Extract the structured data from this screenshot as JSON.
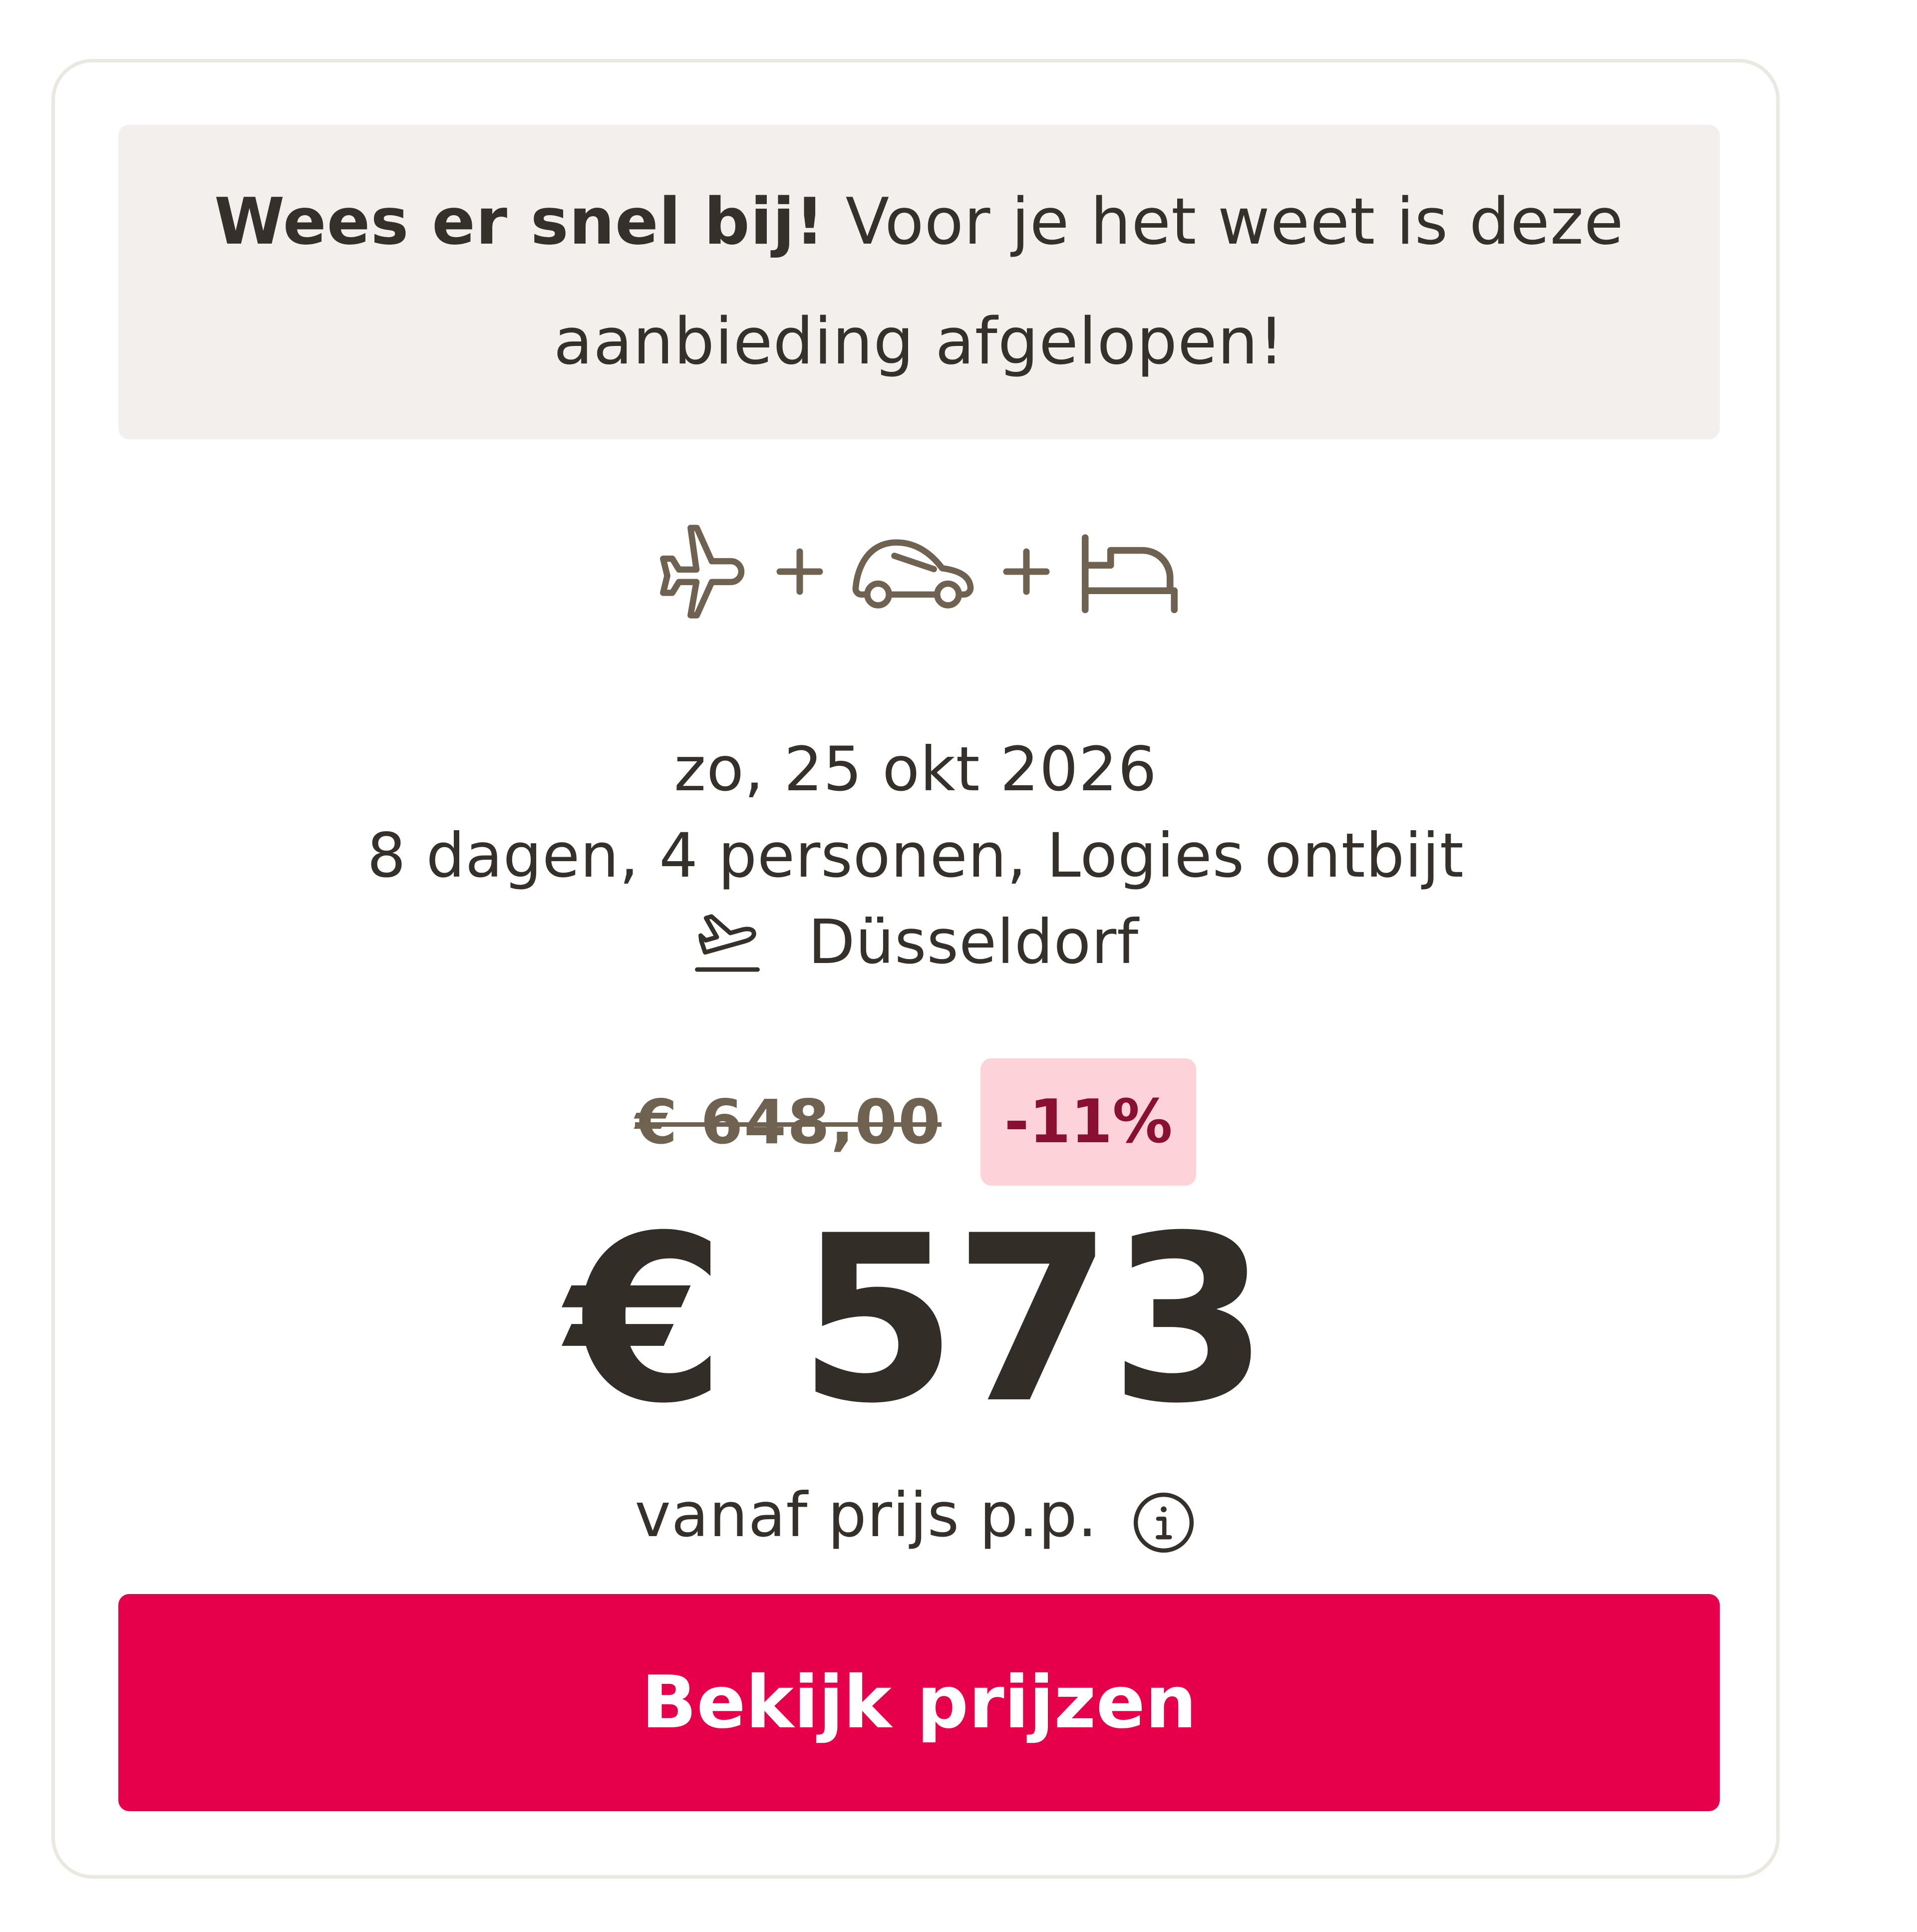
{
  "notice": {
    "bold": "Wees er snel bij!",
    "text": " Voor je het weet is deze aanbieding afgelopen!"
  },
  "package": {
    "icons": [
      "plane-icon",
      "car-icon",
      "bed-icon"
    ],
    "separator": "+"
  },
  "trip": {
    "date": "zo, 25 okt 2026",
    "details": "8 dagen, 4 personen, Logies ontbijt",
    "departure_icon": "plane-departure-icon",
    "departure": "Düsseldorf"
  },
  "pricing": {
    "old_price": "€ 648,00",
    "discount": "-11%",
    "price": "€ 573",
    "from_label": "vanaf prijs p.p.",
    "info_icon": "info-icon"
  },
  "cta": {
    "label": "Bekijk prijzen"
  },
  "colors": {
    "accent": "#e6004b",
    "text": "#35302a",
    "icon": "#6f6250",
    "notice_bg": "#f2efec",
    "badge_bg": "#fdd3d8",
    "badge_text": "#8a1030",
    "border": "#ebe7e1"
  }
}
